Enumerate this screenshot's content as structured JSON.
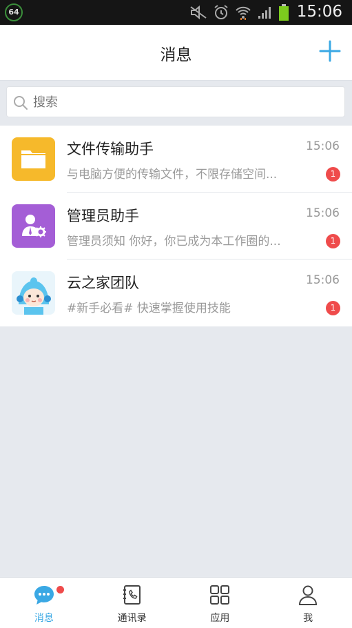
{
  "status_bar": {
    "battery_badge": "64",
    "time": "15:06"
  },
  "header": {
    "title": "消息",
    "add_icon": "plus-icon"
  },
  "search": {
    "placeholder": "搜索",
    "icon": "search-icon"
  },
  "conversations": [
    {
      "name": "文件传输助手",
      "time": "15:06",
      "preview": "与电脑方便的传输文件，不限存储空间...",
      "unread": "1",
      "avatar": "folder-icon",
      "color": "#f6b92b"
    },
    {
      "name": "管理员助手",
      "time": "15:06",
      "preview": "管理员须知 你好，你已成为本工作圈的...",
      "unread": "1",
      "avatar": "admin-icon",
      "color": "#a45ed6"
    },
    {
      "name": "云之家团队",
      "time": "15:06",
      "preview": "#新手必看# 快速掌握使用技能",
      "unread": "1",
      "avatar": "mascot-avatar",
      "color": "#e9f5fb"
    }
  ],
  "tabs": [
    {
      "label": "消息",
      "icon": "chat-bubble-icon",
      "active": true
    },
    {
      "label": "通讯录",
      "icon": "contacts-book-icon",
      "active": false
    },
    {
      "label": "应用",
      "icon": "apps-grid-icon",
      "active": false
    },
    {
      "label": "我",
      "icon": "person-icon",
      "active": false
    }
  ],
  "colors": {
    "accent": "#3aa8e4",
    "badge": "#ef4b4b",
    "background": "#e6e9ee"
  }
}
